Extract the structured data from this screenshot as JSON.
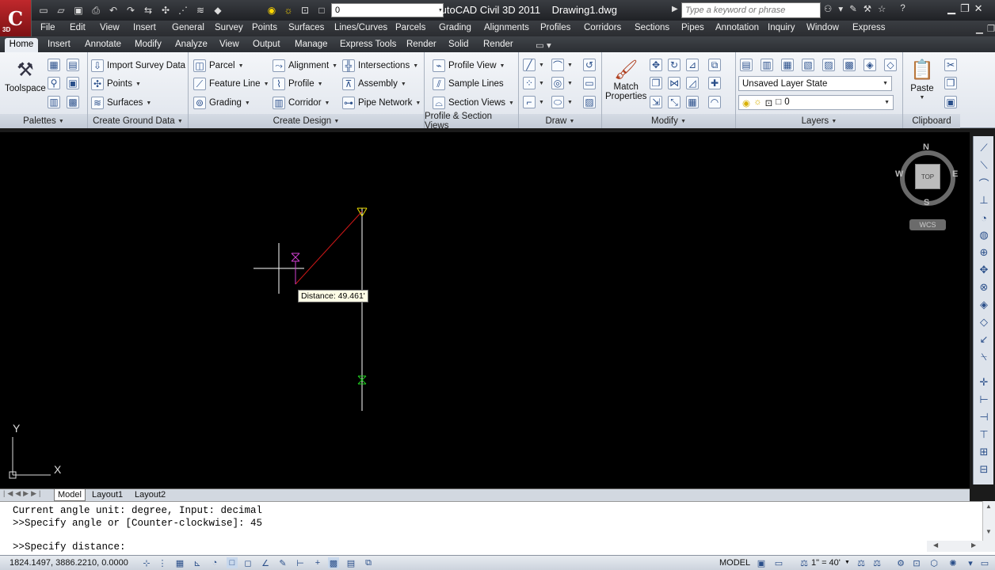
{
  "title": {
    "app": "AutoCAD Civil 3D 2011",
    "doc": "Drawing1.dwg",
    "search_placeholder": "Type a keyword or phrase",
    "layer_value": "0",
    "logo_badge": "3D"
  },
  "menu": [
    "File",
    "Edit",
    "View",
    "Insert",
    "General",
    "Survey",
    "Points",
    "Surfaces",
    "Lines/Curves",
    "Parcels",
    "Grading",
    "Alignments",
    "Profiles",
    "Corridors",
    "Sections",
    "Pipes",
    "Annotation",
    "Inquiry",
    "Window",
    "Express"
  ],
  "tabs": [
    "Home",
    "Insert",
    "Annotate",
    "Modify",
    "Analyze",
    "View",
    "Output",
    "Manage",
    "Express Tools",
    "Render",
    "Solid",
    "Render"
  ],
  "ribbon": {
    "palettes": {
      "toolspace": "Toolspace",
      "footer": "Palettes"
    },
    "ground": {
      "items": [
        "Import Survey Data",
        "Points",
        "Surfaces"
      ],
      "footer": "Create Ground Data"
    },
    "design": {
      "col1": [
        "Parcel",
        "Feature Line",
        "Grading"
      ],
      "col2": [
        "Alignment",
        "Profile",
        "Corridor"
      ],
      "col3": [
        "Intersections",
        "Assembly",
        "Pipe Network"
      ],
      "footer": "Create Design"
    },
    "profile": {
      "items": [
        "Profile View",
        "Sample Lines",
        "Section Views"
      ],
      "footer": "Profile & Section Views"
    },
    "draw": {
      "footer": "Draw"
    },
    "modify": {
      "match1": "Match",
      "match2": "Properties",
      "footer": "Modify"
    },
    "layers": {
      "state": "Unsaved Layer State",
      "layer": "0",
      "footer": "Layers"
    },
    "clipboard": {
      "paste": "Paste",
      "footer": "Clipboard"
    }
  },
  "drawing": {
    "tooltip": "Distance: 49.461'",
    "compass": {
      "n": "N",
      "s": "S",
      "e": "E",
      "w": "W",
      "cube": "TOP",
      "wcs": "WCS"
    },
    "ucs_y": "Y",
    "ucs_x": "X"
  },
  "layout_tabs": [
    "Model",
    "Layout1",
    "Layout2"
  ],
  "command": {
    "lines": [
      "Current angle unit: degree, Input: decimal",
      ">>Specify angle or [Counter-clockwise]: 45",
      ">>Specify distance:"
    ]
  },
  "status": {
    "coords": "1824.1497, 3886.2210, 0.0000",
    "model": "MODEL",
    "scale": "1\" = 40'"
  },
  "colors": {
    "accent": "#c0282c",
    "viewport": "#000000"
  }
}
